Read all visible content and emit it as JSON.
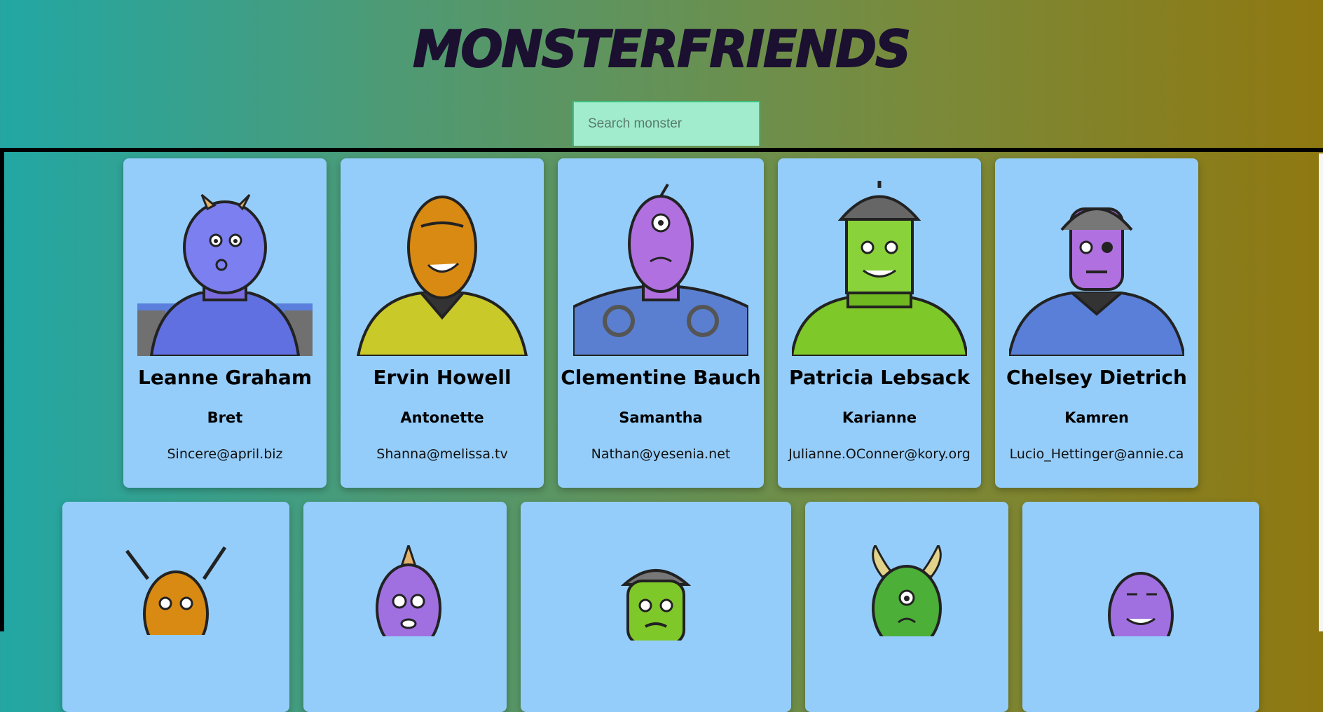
{
  "app": {
    "title": "MONSTERFRIENDS"
  },
  "search": {
    "placeholder": "Search monster"
  },
  "colors": {
    "card_bg": "#95cdfa",
    "search_bg": "#a0eccd",
    "title_color": "#1b1030"
  },
  "monsters_row1": [
    {
      "name": "Leanne Graham",
      "username": "Bret",
      "email": "Sincere@april.biz",
      "icon": "blue-horned-monster-icon"
    },
    {
      "name": "Ervin Howell",
      "username": "Antonette",
      "email": "Shanna@melissa.tv",
      "icon": "orange-spiky-monster-icon"
    },
    {
      "name": "Clementine Bauch",
      "username": "Samantha",
      "email": "Nathan@yesenia.net",
      "icon": "purple-cyclops-monster-icon"
    },
    {
      "name": "Patricia Lebsack",
      "username": "Karianne",
      "email": "Julianne.OConner@kory.org",
      "icon": "green-helmet-monster-icon"
    },
    {
      "name": "Chelsey Dietrich",
      "username": "Kamren",
      "email": "Lucio_Hettinger@annie.ca",
      "icon": "purple-robot-monster-icon"
    }
  ],
  "monsters_row2": [
    {
      "icon": "orange-antenna-monster-icon"
    },
    {
      "icon": "purple-horn-monster-icon"
    },
    {
      "icon": "green-robot-monster-icon"
    },
    {
      "icon": "green-horned-monster-icon"
    },
    {
      "icon": "purple-grin-monster-icon"
    }
  ]
}
